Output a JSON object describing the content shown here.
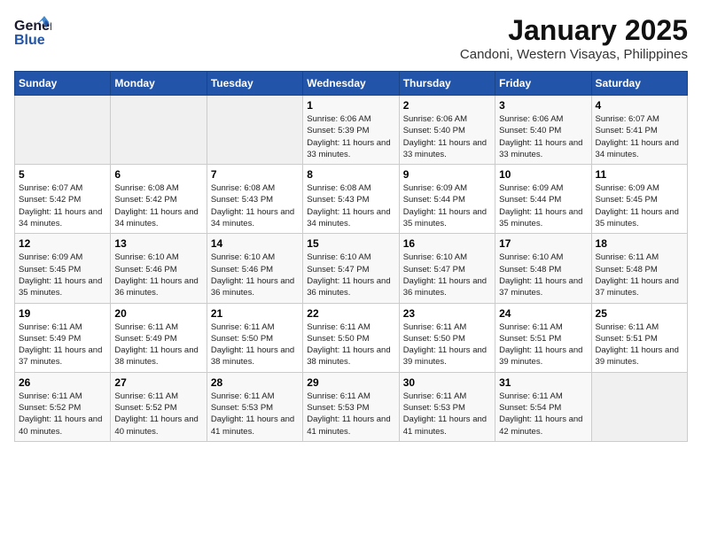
{
  "header": {
    "logo_general": "General",
    "logo_blue": "Blue",
    "title": "January 2025",
    "subtitle": "Candoni, Western Visayas, Philippines"
  },
  "days_of_week": [
    "Sunday",
    "Monday",
    "Tuesday",
    "Wednesday",
    "Thursday",
    "Friday",
    "Saturday"
  ],
  "weeks": [
    [
      {
        "day": "",
        "info": ""
      },
      {
        "day": "",
        "info": ""
      },
      {
        "day": "",
        "info": ""
      },
      {
        "day": "1",
        "sunrise": "6:06 AM",
        "sunset": "5:39 PM",
        "daylight": "11 hours and 33 minutes."
      },
      {
        "day": "2",
        "sunrise": "6:06 AM",
        "sunset": "5:40 PM",
        "daylight": "11 hours and 33 minutes."
      },
      {
        "day": "3",
        "sunrise": "6:06 AM",
        "sunset": "5:40 PM",
        "daylight": "11 hours and 33 minutes."
      },
      {
        "day": "4",
        "sunrise": "6:07 AM",
        "sunset": "5:41 PM",
        "daylight": "11 hours and 34 minutes."
      }
    ],
    [
      {
        "day": "5",
        "sunrise": "6:07 AM",
        "sunset": "5:42 PM",
        "daylight": "11 hours and 34 minutes."
      },
      {
        "day": "6",
        "sunrise": "6:08 AM",
        "sunset": "5:42 PM",
        "daylight": "11 hours and 34 minutes."
      },
      {
        "day": "7",
        "sunrise": "6:08 AM",
        "sunset": "5:43 PM",
        "daylight": "11 hours and 34 minutes."
      },
      {
        "day": "8",
        "sunrise": "6:08 AM",
        "sunset": "5:43 PM",
        "daylight": "11 hours and 34 minutes."
      },
      {
        "day": "9",
        "sunrise": "6:09 AM",
        "sunset": "5:44 PM",
        "daylight": "11 hours and 35 minutes."
      },
      {
        "day": "10",
        "sunrise": "6:09 AM",
        "sunset": "5:44 PM",
        "daylight": "11 hours and 35 minutes."
      },
      {
        "day": "11",
        "sunrise": "6:09 AM",
        "sunset": "5:45 PM",
        "daylight": "11 hours and 35 minutes."
      }
    ],
    [
      {
        "day": "12",
        "sunrise": "6:09 AM",
        "sunset": "5:45 PM",
        "daylight": "11 hours and 35 minutes."
      },
      {
        "day": "13",
        "sunrise": "6:10 AM",
        "sunset": "5:46 PM",
        "daylight": "11 hours and 36 minutes."
      },
      {
        "day": "14",
        "sunrise": "6:10 AM",
        "sunset": "5:46 PM",
        "daylight": "11 hours and 36 minutes."
      },
      {
        "day": "15",
        "sunrise": "6:10 AM",
        "sunset": "5:47 PM",
        "daylight": "11 hours and 36 minutes."
      },
      {
        "day": "16",
        "sunrise": "6:10 AM",
        "sunset": "5:47 PM",
        "daylight": "11 hours and 36 minutes."
      },
      {
        "day": "17",
        "sunrise": "6:10 AM",
        "sunset": "5:48 PM",
        "daylight": "11 hours and 37 minutes."
      },
      {
        "day": "18",
        "sunrise": "6:11 AM",
        "sunset": "5:48 PM",
        "daylight": "11 hours and 37 minutes."
      }
    ],
    [
      {
        "day": "19",
        "sunrise": "6:11 AM",
        "sunset": "5:49 PM",
        "daylight": "11 hours and 37 minutes."
      },
      {
        "day": "20",
        "sunrise": "6:11 AM",
        "sunset": "5:49 PM",
        "daylight": "11 hours and 38 minutes."
      },
      {
        "day": "21",
        "sunrise": "6:11 AM",
        "sunset": "5:50 PM",
        "daylight": "11 hours and 38 minutes."
      },
      {
        "day": "22",
        "sunrise": "6:11 AM",
        "sunset": "5:50 PM",
        "daylight": "11 hours and 38 minutes."
      },
      {
        "day": "23",
        "sunrise": "6:11 AM",
        "sunset": "5:50 PM",
        "daylight": "11 hours and 39 minutes."
      },
      {
        "day": "24",
        "sunrise": "6:11 AM",
        "sunset": "5:51 PM",
        "daylight": "11 hours and 39 minutes."
      },
      {
        "day": "25",
        "sunrise": "6:11 AM",
        "sunset": "5:51 PM",
        "daylight": "11 hours and 39 minutes."
      }
    ],
    [
      {
        "day": "26",
        "sunrise": "6:11 AM",
        "sunset": "5:52 PM",
        "daylight": "11 hours and 40 minutes."
      },
      {
        "day": "27",
        "sunrise": "6:11 AM",
        "sunset": "5:52 PM",
        "daylight": "11 hours and 40 minutes."
      },
      {
        "day": "28",
        "sunrise": "6:11 AM",
        "sunset": "5:53 PM",
        "daylight": "11 hours and 41 minutes."
      },
      {
        "day": "29",
        "sunrise": "6:11 AM",
        "sunset": "5:53 PM",
        "daylight": "11 hours and 41 minutes."
      },
      {
        "day": "30",
        "sunrise": "6:11 AM",
        "sunset": "5:53 PM",
        "daylight": "11 hours and 41 minutes."
      },
      {
        "day": "31",
        "sunrise": "6:11 AM",
        "sunset": "5:54 PM",
        "daylight": "11 hours and 42 minutes."
      },
      {
        "day": "",
        "info": ""
      }
    ]
  ],
  "labels": {
    "sunrise_prefix": "Sunrise: ",
    "sunset_prefix": "Sunset: ",
    "daylight_prefix": "Daylight: "
  }
}
